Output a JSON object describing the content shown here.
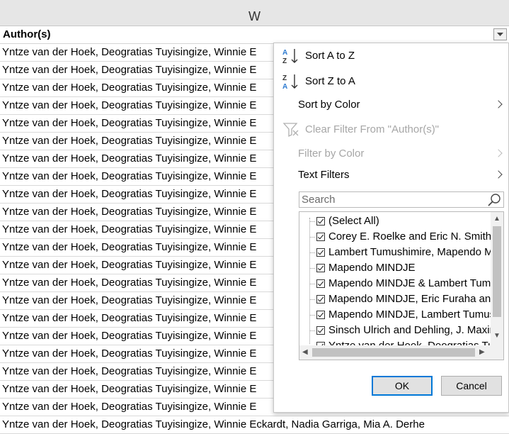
{
  "sheet": {
    "column_letter": "W",
    "field_name": "Author(s)",
    "row_text": "Yntze van der Hoek, Deogratias Tuyisingize, Winnie E",
    "last_row_text": "Yntze van der Hoek, Deogratias Tuyisingize, Winnie Eckardt, Nadia Garriga, Mia A. Derhe",
    "rows": [
      "Yntze van der Hoek, Deogratias Tuyisingize, Winnie E",
      "Yntze van der Hoek, Deogratias Tuyisingize, Winnie E",
      "Yntze van der Hoek, Deogratias Tuyisingize, Winnie E",
      "Yntze van der Hoek, Deogratias Tuyisingize, Winnie E",
      "Yntze van der Hoek, Deogratias Tuyisingize, Winnie E",
      "Yntze van der Hoek, Deogratias Tuyisingize, Winnie E",
      "Yntze van der Hoek, Deogratias Tuyisingize, Winnie E",
      "Yntze van der Hoek, Deogratias Tuyisingize, Winnie E",
      "Yntze van der Hoek, Deogratias Tuyisingize, Winnie E",
      "Yntze van der Hoek, Deogratias Tuyisingize, Winnie E",
      "Yntze van der Hoek, Deogratias Tuyisingize, Winnie E",
      "Yntze van der Hoek, Deogratias Tuyisingize, Winnie E",
      "Yntze van der Hoek, Deogratias Tuyisingize, Winnie E",
      "Yntze van der Hoek, Deogratias Tuyisingize, Winnie E",
      "Yntze van der Hoek, Deogratias Tuyisingize, Winnie E",
      "Yntze van der Hoek, Deogratias Tuyisingize, Winnie E",
      "Yntze van der Hoek, Deogratias Tuyisingize, Winnie E",
      "Yntze van der Hoek, Deogratias Tuyisingize, Winnie E",
      "Yntze van der Hoek, Deogratias Tuyisingize, Winnie E",
      "Yntze van der Hoek, Deogratias Tuyisingize, Winnie E",
      "Yntze van der Hoek, Deogratias Tuyisingize, Winnie E"
    ]
  },
  "menu": {
    "sort_az": "Sort A to Z",
    "sort_za": "Sort Z to A",
    "sort_by_color": "Sort by Color",
    "clear_filter": "Clear Filter From \"Author(s)\"",
    "filter_by_color": "Filter by Color",
    "text_filters": "Text Filters",
    "search_placeholder": "Search",
    "icons": {
      "sort_az": "sort-ascending-icon",
      "sort_za": "sort-descending-icon",
      "clear_filter": "clear-filter-icon",
      "search": "search-icon"
    }
  },
  "filter_list": {
    "items": [
      {
        "label": "(Select All)",
        "checked": true
      },
      {
        "label": "Corey E. Roelke and Eric N. Smith",
        "checked": true
      },
      {
        "label": "Lambert Tumushimire, Mapendo MINDJE",
        "checked": true
      },
      {
        "label": "Mapendo MINDJE",
        "checked": true
      },
      {
        "label": "Mapendo MINDJE & Lambert Tumushimire",
        "checked": true
      },
      {
        "label": "Mapendo MINDJE, Eric Furaha and",
        "checked": true
      },
      {
        "label": "Mapendo MINDJE, Lambert Tumushimire",
        "checked": true
      },
      {
        "label": "Sinsch Ulrich and Dehling, J. Maximilian",
        "checked": true
      },
      {
        "label": "Yntze van der Hoek, Deogratias Tuyisingize",
        "checked": true
      }
    ]
  },
  "buttons": {
    "ok": "OK",
    "cancel": "Cancel"
  },
  "colors": {
    "accent": "#0078d7",
    "icon_blue": "#2b79d0",
    "disabled_text": "#a6a6a6"
  }
}
